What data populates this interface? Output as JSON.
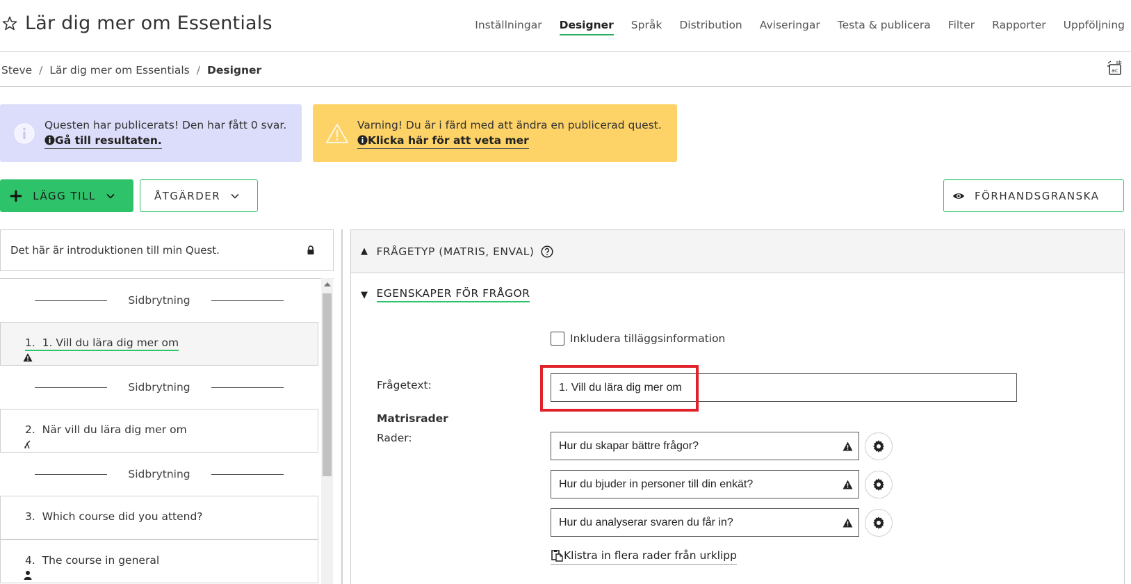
{
  "header": {
    "title": "Lär dig mer om Essentials",
    "tabs": [
      {
        "label": "Inställningar",
        "active": false
      },
      {
        "label": "Designer",
        "active": true
      },
      {
        "label": "Språk",
        "active": false
      },
      {
        "label": "Distribution",
        "active": false
      },
      {
        "label": "Aviseringar",
        "active": false
      },
      {
        "label": "Testa & publicera",
        "active": false
      },
      {
        "label": "Filter",
        "active": false
      },
      {
        "label": "Rapporter",
        "active": false
      },
      {
        "label": "Uppföljning",
        "active": false
      }
    ]
  },
  "breadcrumb": {
    "items": [
      "Steve",
      "Lär dig mer om Essentials",
      "Designer"
    ],
    "separator": "/"
  },
  "banners": {
    "info": {
      "text": "Questen har publicerats! Den har fått 0 svar.",
      "link": "Gå till resultaten."
    },
    "warning": {
      "text": "Varning! Du är i färd med att ändra en publicerad quest.",
      "link": "Klicka här för att veta mer"
    }
  },
  "toolbar": {
    "add_label": "LÄGG TILL",
    "actions_label": "ÅTGÄRDER",
    "preview_label": "FÖRHANDSGRANSKA"
  },
  "left_panel": {
    "intro": "Det här är introduktionen till min Quest.",
    "page_break_label": "Sidbrytning",
    "questions": [
      {
        "number": "1.",
        "text": "1. Vill du lära dig mer om",
        "icon": "warning-icon"
      },
      {
        "number": "2.",
        "text": "När vill du lära dig mer om",
        "icon": "logic-icon"
      },
      {
        "number": "3.",
        "text": "Which course did you attend?",
        "icon": ""
      },
      {
        "number": "4.",
        "text": "The course in general",
        "icon": "person-icon"
      }
    ]
  },
  "right_panel": {
    "question_type_header": "FRÅGETYP (MATRIS, ENVAL)",
    "properties_header": "EGENSKAPER FÖR FRÅGOR",
    "include_additional_info": "Inkludera tilläggsinformation",
    "question_text_label": "Frågetext:",
    "question_text_value": "1. Vill du lära dig mer om",
    "matrix_rows_heading": "Matrisrader",
    "rows_label": "Rader:",
    "rows": [
      "Hur du skapar bättre frågor?",
      "Hur du bjuder in personer till din enkät?",
      "Hur du analyserar svaren du får in?"
    ],
    "paste_rows_label": "Klistra in flera rader från urklipp"
  },
  "colors": {
    "accent_green": "#2ec36a",
    "info_banner": "#dcdcfb",
    "warning_banner": "#fdd266",
    "highlight_red": "#e0202a"
  }
}
